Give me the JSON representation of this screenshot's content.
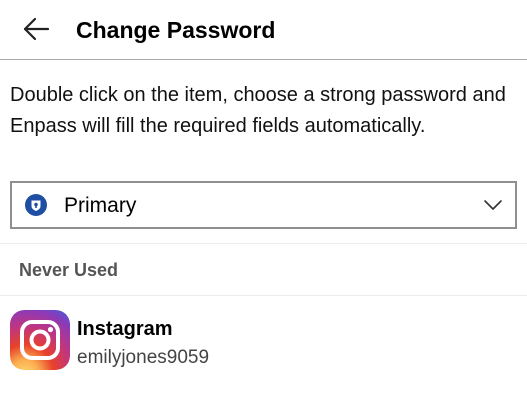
{
  "header": {
    "back_icon": "arrow-left-icon",
    "title": "Change Password"
  },
  "instructions": "Double click on the item, choose a strong password and Enpass will fill the required fields automatically.",
  "vault_selector": {
    "icon": "enpass-vault-icon",
    "selected": "Primary",
    "chevron_icon": "chevron-down-icon",
    "vault_color": "#1e4fa3"
  },
  "section": {
    "label": "Never Used"
  },
  "items": [
    {
      "icon": "instagram-icon",
      "title": "Instagram",
      "subtitle": "emilyjones9059"
    }
  ],
  "colors": {
    "header_border": "#a9a9a9",
    "select_border": "#8f8f8f",
    "section_text": "#555555",
    "subtitle_text": "#444444"
  }
}
